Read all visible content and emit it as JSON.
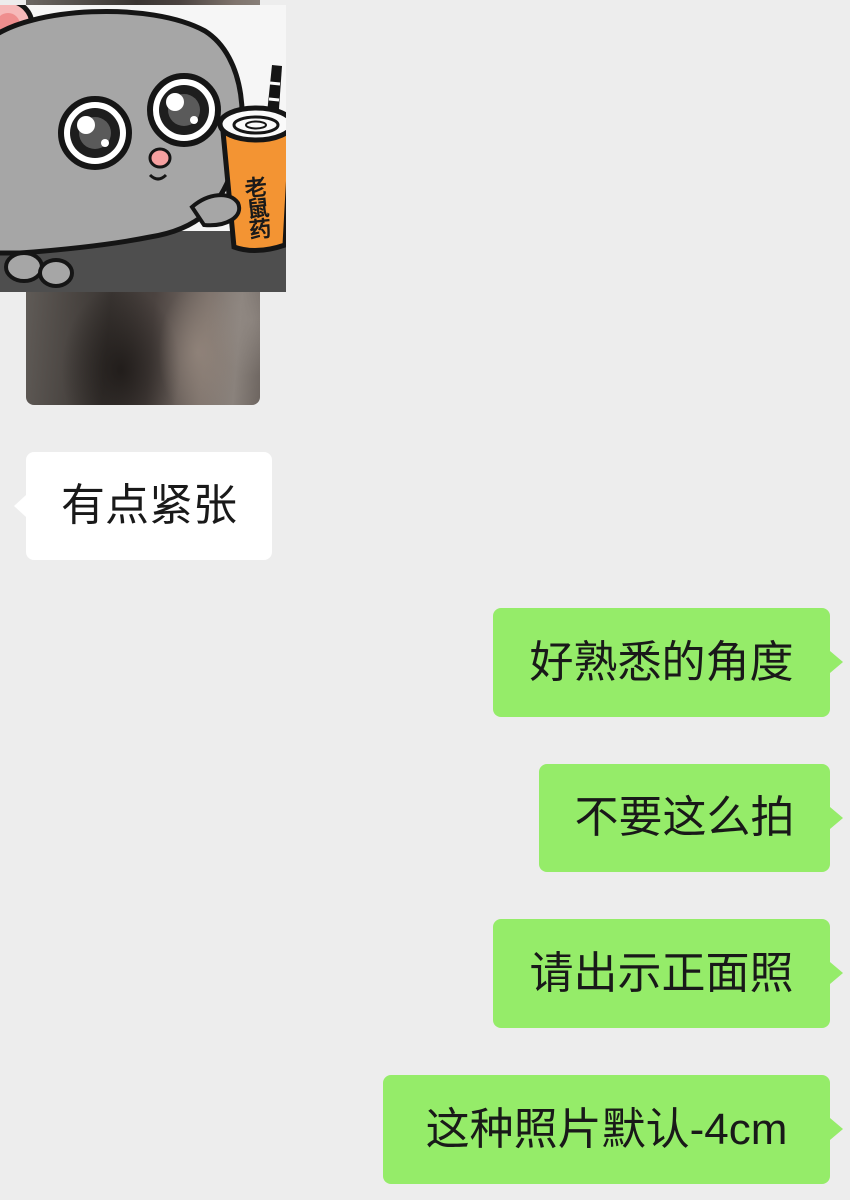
{
  "colors": {
    "background": "#EDEDED",
    "incoming_bubble": "#FFFFFF",
    "outgoing_bubble": "#95EC69",
    "message_text": "#191919",
    "sticker_cup": "#F39433",
    "sticker_mouse": "#A6A6A6"
  },
  "incoming": {
    "sticker": {
      "icon": "mouse-holding-drink-icon",
      "cup_text": "老鼠药"
    },
    "messages": [
      {
        "text": "有点紧张"
      }
    ]
  },
  "outgoing": {
    "messages": [
      {
        "text": "好熟悉的角度"
      },
      {
        "text": "不要这么拍"
      },
      {
        "text": "请出示正面照"
      },
      {
        "text": "这种照片默认-4cm"
      }
    ]
  }
}
